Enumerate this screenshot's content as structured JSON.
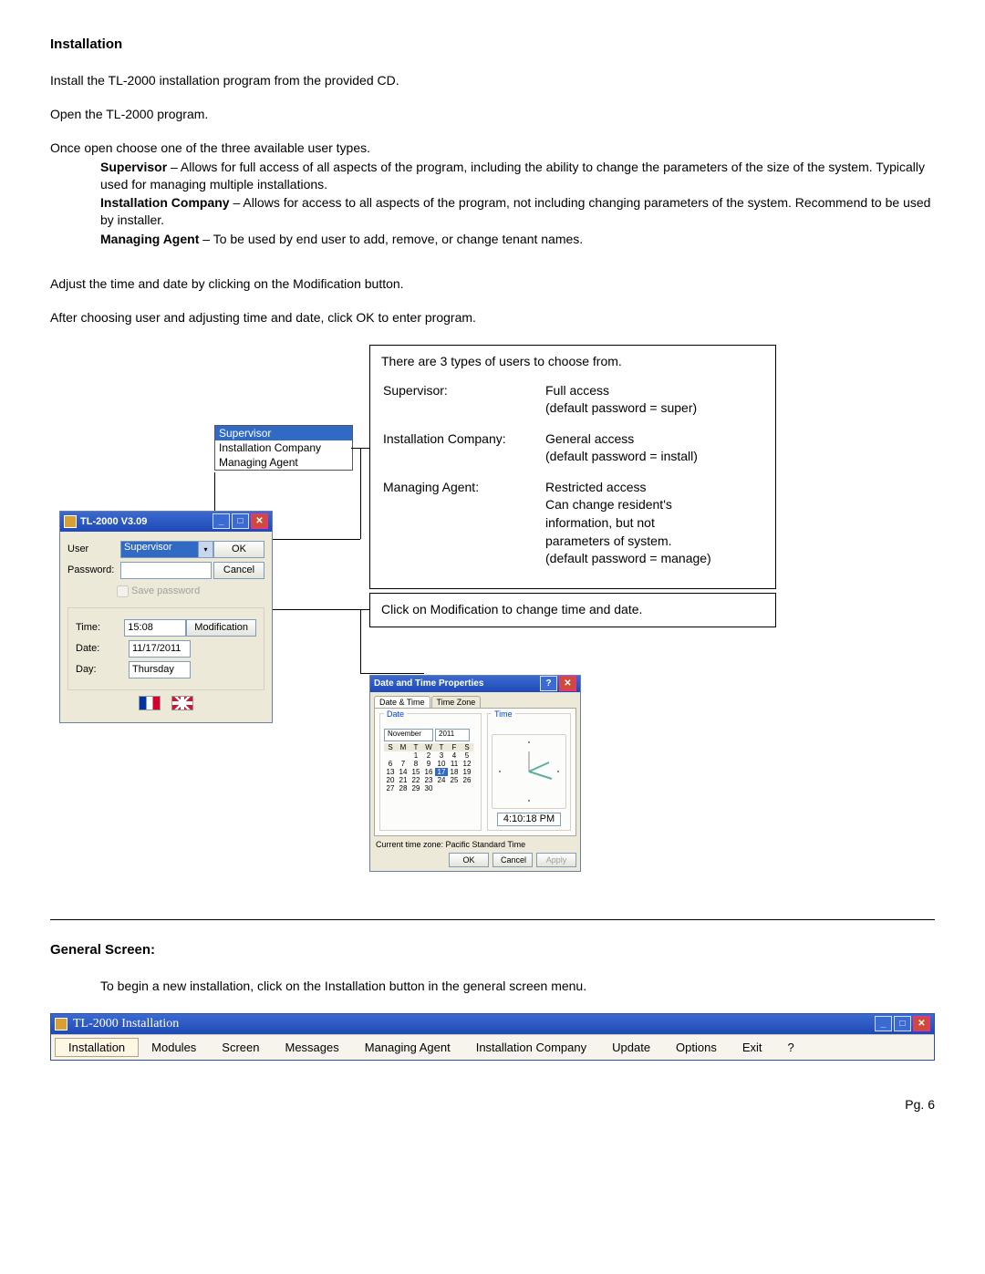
{
  "heading": "Installation",
  "para1": "Install the TL-2000 installation program from the provided CD.",
  "para2": "Open the TL-2000 program.",
  "para3": "Once open choose one of the three available user types.",
  "bullets": {
    "supervisor_lbl": "Supervisor",
    "supervisor_txt": " – Allows for full access of all aspects of the program, including the ability to change the parameters of the size of the system.  Typically used for managing multiple installations.",
    "ic_lbl": "Installation Company",
    "ic_txt": " – Allows for access to all aspects of the program, not including changing parameters of the system.  Recommend to be used by installer.",
    "ma_lbl": "Managing Agent",
    "ma_txt": " – To be used by end user to add, remove, or change tenant names."
  },
  "para4": "Adjust the time and date by clicking on the Modification button.",
  "para5": "After choosing user and adjusting time and date, click OK to enter program.",
  "callout1": {
    "intro": "There are 3 types of users to choose from.",
    "rows": [
      {
        "k": "Supervisor:",
        "v": "Full access\n(default password = super)"
      },
      {
        "k": "Installation Company:",
        "v": "General access\n(default password = install)"
      },
      {
        "k": "Managing Agent:",
        "v": "Restricted access\nCan change resident's\ninformation, but not\nparameters of system.\n(default password = manage)"
      }
    ]
  },
  "callout2": "Click on Modification to change time and date.",
  "droplist": {
    "items": [
      "Supervisor",
      "Installation Company",
      "Managing Agent"
    ]
  },
  "login": {
    "title": "TL-2000  V3.09",
    "user_lbl": "User",
    "user_val": "Supervisor",
    "pwd_lbl": "Password:",
    "save_lbl": "Save password",
    "ok": "OK",
    "cancel": "Cancel",
    "time_lbl": "Time:",
    "time_val": "15:08",
    "date_lbl": "Date:",
    "date_val": "11/17/2011",
    "day_lbl": "Day:",
    "day_val": "Thursday",
    "mod": "Modification"
  },
  "dt": {
    "title": "Date and Time Properties",
    "tabs": [
      "Date & Time",
      "Time Zone"
    ],
    "date_leg": "Date",
    "time_leg": "Time",
    "month": "November",
    "year": "2011",
    "dow": [
      "S",
      "M",
      "T",
      "W",
      "T",
      "F",
      "S"
    ],
    "days": [
      "",
      "",
      "1",
      "2",
      "3",
      "4",
      "5",
      "6",
      "7",
      "8",
      "9",
      "10",
      "11",
      "12",
      "13",
      "14",
      "15",
      "16",
      "17",
      "18",
      "19",
      "20",
      "21",
      "22",
      "23",
      "24",
      "25",
      "26",
      "27",
      "28",
      "29",
      "30",
      "",
      "",
      ""
    ],
    "today": "17",
    "clock": "4:10:18 PM",
    "tz": "Current time zone: Pacific Standard Time",
    "ok": "OK",
    "cancel": "Cancel",
    "apply": "Apply"
  },
  "gs_heading": "General Screen:",
  "gs_para": "To begin a new installation, click on the Installation button in the general screen menu.",
  "menubar": {
    "title": "TL-2000 Installation",
    "items": [
      "Installation",
      "Modules",
      "Screen",
      "Messages",
      "Managing Agent",
      "Installation Company",
      "Update",
      "Options",
      "Exit",
      "?"
    ]
  },
  "footer": "Pg. 6"
}
